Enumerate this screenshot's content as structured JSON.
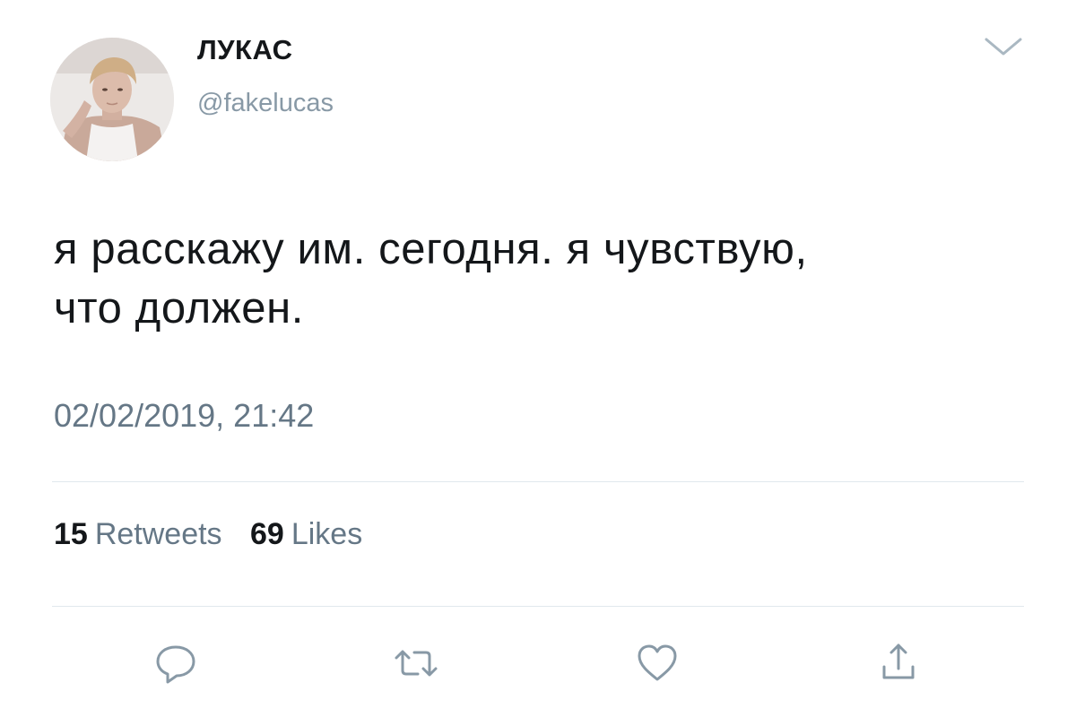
{
  "author": {
    "display_name": "ЛУКАС",
    "handle": "@fakelucas"
  },
  "tweet": {
    "text_line1": "я расскажу им. сегодня. я чувствую,",
    "text_line2": "что должен.",
    "timestamp": "02/02/2019, 21:42"
  },
  "stats": {
    "retweets_count": "15",
    "retweets_label": "Retweets",
    "likes_count": "69",
    "likes_label": "Likes"
  },
  "icons": {
    "menu": "chevron-down-icon",
    "reply": "reply-bubble-icon",
    "retweet": "retweet-icon",
    "like": "heart-icon",
    "share": "share-icon"
  },
  "colors": {
    "text_primary": "#14171a",
    "text_secondary": "#657786",
    "handle": "#8899a6",
    "divider": "#e1e8ed",
    "icon": "#8899a6"
  }
}
